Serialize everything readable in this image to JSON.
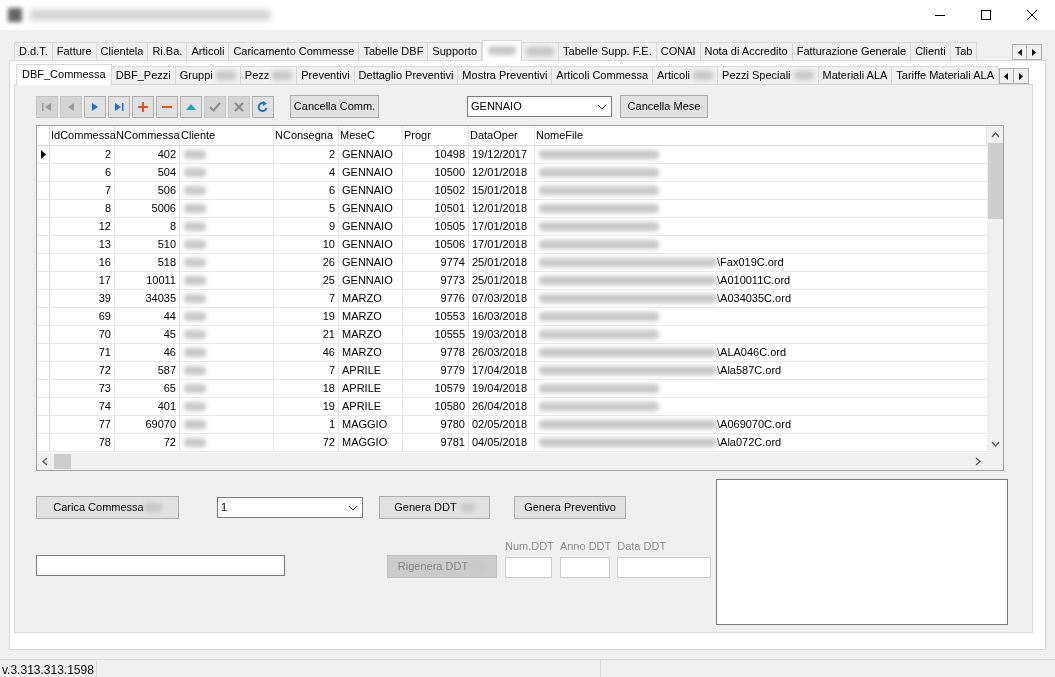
{
  "window": {
    "title_redacted": true
  },
  "tabs": [
    {
      "label": "D.d.T.",
      "selected": false
    },
    {
      "label": "Fatture",
      "selected": false
    },
    {
      "label": "Clientela",
      "selected": false
    },
    {
      "label": "Ri.Ba.",
      "selected": false
    },
    {
      "label": "Articoli",
      "selected": false
    },
    {
      "label": "Caricamento Commesse",
      "selected": false
    },
    {
      "label": "Tabelle DBF",
      "selected": false
    },
    {
      "label": "Supporto",
      "selected": false
    },
    {
      "label_redacted": true,
      "selected": true
    },
    {
      "label_redacted": true,
      "selected": false
    },
    {
      "label": "Tabelle Supp. F.E.",
      "selected": false
    },
    {
      "label": "CONAI",
      "selected": false
    },
    {
      "label": "Nota di Accredito",
      "selected": false
    },
    {
      "label": "Fatturazione Generale",
      "selected": false
    },
    {
      "label": "Clienti",
      "selected": false
    },
    {
      "label": "Tab",
      "selected": false
    }
  ],
  "subtabs": [
    {
      "label": "DBF_Commessa",
      "selected": true
    },
    {
      "label": "DBF_Pezzi",
      "selected": false
    },
    {
      "label": "Gruppi",
      "label_redacted": true,
      "selected": false
    },
    {
      "label": "Pezz",
      "label_redacted": true,
      "selected": false
    },
    {
      "label": "Preventivi",
      "selected": false
    },
    {
      "label": "Dettaglio Preventivi",
      "selected": false
    },
    {
      "label": "Mostra Preventivi",
      "selected": false
    },
    {
      "label": "Articoli Commessa",
      "selected": false
    },
    {
      "label": "Articoli",
      "label_redacted": true,
      "selected": false
    },
    {
      "label": "Pezzi Speciali",
      "label_redacted": true,
      "selected": false
    },
    {
      "label": "Materiali ALA",
      "selected": false
    },
    {
      "label": "Tariffe Materiali ALA",
      "selected": false
    }
  ],
  "navigator": [
    {
      "kind": "first",
      "disabled": true
    },
    {
      "kind": "prior",
      "disabled": true
    },
    {
      "kind": "next",
      "disabled": false
    },
    {
      "kind": "last",
      "disabled": false
    },
    {
      "kind": "insert",
      "disabled": false
    },
    {
      "kind": "delete",
      "disabled": false
    },
    {
      "kind": "edit",
      "disabled": false
    },
    {
      "kind": "post",
      "disabled": true
    },
    {
      "kind": "cancel",
      "disabled": true
    },
    {
      "kind": "refresh",
      "disabled": false
    }
  ],
  "cancel_order_button": "Cancella Comm.",
  "month_select": {
    "value": "GENNAIO"
  },
  "cancel_month_button": "Cancella Mese",
  "table": {
    "columns": [
      {
        "label": "IdCommessa",
        "kind": "number"
      },
      {
        "label": "NCommessa",
        "kind": "number"
      },
      {
        "label": "Cliente",
        "kind": "redacted"
      },
      {
        "label": "NConsegna",
        "kind": "number"
      },
      {
        "label": "MeseC",
        "kind": "text"
      },
      {
        "label": "Progr",
        "kind": "number"
      },
      {
        "label": "DataOper",
        "kind": "text"
      },
      {
        "label": "NomeFile",
        "kind": "path"
      }
    ],
    "rows": [
      {
        "current": true,
        "values": [
          "2",
          "402",
          "2",
          "GENNAIO",
          "10498",
          "19/12/2017"
        ]
      },
      {
        "current": false,
        "values": [
          "6",
          "504",
          "4",
          "GENNAIO",
          "10500",
          "12/01/2018"
        ]
      },
      {
        "current": false,
        "values": [
          "7",
          "506",
          "6",
          "GENNAIO",
          "10502",
          "15/01/2018"
        ]
      },
      {
        "current": false,
        "values": [
          "8",
          "5006",
          "5",
          "GENNAIO",
          "10501",
          "12/01/2018"
        ]
      },
      {
        "current": false,
        "values": [
          "12",
          "8",
          "9",
          "GENNAIO",
          "10505",
          "17/01/2018"
        ]
      },
      {
        "current": false,
        "values": [
          "13",
          "510",
          "10",
          "GENNAIO",
          "10506",
          "17/01/2018"
        ]
      },
      {
        "current": false,
        "values": [
          "16",
          "518",
          "26",
          "GENNAIO",
          "9774",
          "25/01/2018"
        ],
        "file": "\\Fax019C.ord"
      },
      {
        "current": false,
        "values": [
          "17",
          "10011",
          "25",
          "GENNAIO",
          "9773",
          "25/01/2018"
        ],
        "file": "\\A010011C.ord"
      },
      {
        "current": false,
        "values": [
          "39",
          "34035",
          "7",
          "MARZO",
          "9776",
          "07/03/2018"
        ],
        "file": "\\A034035C.ord"
      },
      {
        "current": false,
        "values": [
          "69",
          "44",
          "19",
          "MARZO",
          "10553",
          "16/03/2018"
        ]
      },
      {
        "current": false,
        "values": [
          "70",
          "45",
          "21",
          "MARZO",
          "10555",
          "19/03/2018"
        ]
      },
      {
        "current": false,
        "values": [
          "71",
          "46",
          "46",
          "MARZO",
          "9778",
          "26/03/2018"
        ],
        "file": "\\ALA046C.ord"
      },
      {
        "current": false,
        "values": [
          "72",
          "587",
          "7",
          "APRILE",
          "9779",
          "17/04/2018"
        ],
        "file": "\\Ala587C.ord"
      },
      {
        "current": false,
        "values": [
          "73",
          "65",
          "18",
          "APRILE",
          "10579",
          "19/04/2018"
        ]
      },
      {
        "current": false,
        "values": [
          "74",
          "401",
          "19",
          "APRILE",
          "10580",
          "26/04/2018"
        ]
      },
      {
        "current": false,
        "values": [
          "77",
          "69070",
          "1",
          "MAGGIO",
          "9780",
          "02/05/2018"
        ],
        "file": "\\A069070C.ord"
      },
      {
        "current": false,
        "values": [
          "78",
          "72",
          "72",
          "MAGGIO",
          "9781",
          "04/05/2018"
        ],
        "file": "\\Ala072C.ord"
      }
    ]
  },
  "load_button": {
    "label": "Carica Commessa",
    "label_redacted": true
  },
  "number_select": {
    "value": "1"
  },
  "generate_ddt_button": {
    "label": "Genera DDT",
    "label_redacted": true
  },
  "generate_quote_button": {
    "label": "Genera Preventivo"
  },
  "regenerate_button": {
    "label": "Rigenera DDT",
    "label_redacted": true,
    "disabled": true
  },
  "ddt_fields": [
    {
      "label": "Num.DDT"
    },
    {
      "label": "Anno DDT"
    },
    {
      "label": "Data DDT"
    }
  ],
  "status_bar": {
    "version": "v.3.313.313.1598"
  }
}
